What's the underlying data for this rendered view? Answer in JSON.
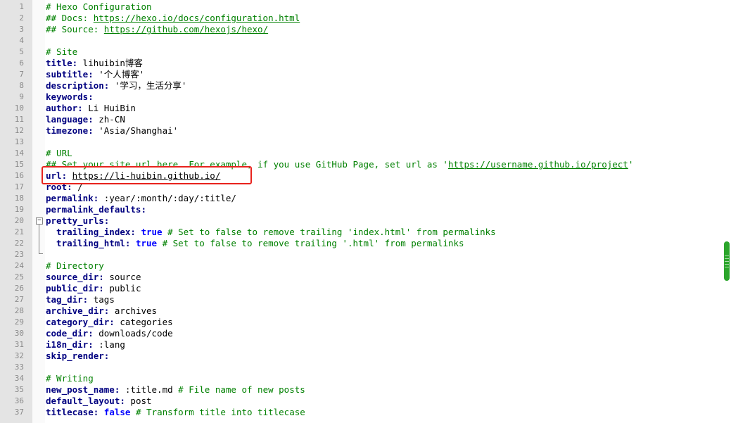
{
  "editor": {
    "lines": [
      {
        "n": "1",
        "parts": [
          {
            "t": "# Hexo Configuration",
            "c": "cm"
          }
        ]
      },
      {
        "n": "2",
        "parts": [
          {
            "t": "## Docs: ",
            "c": "cm"
          },
          {
            "t": "https://hexo.io/docs/configuration.html",
            "c": "ul"
          }
        ]
      },
      {
        "n": "3",
        "parts": [
          {
            "t": "## Source: ",
            "c": "cm"
          },
          {
            "t": "https://github.com/hexojs/hexo/",
            "c": "ul"
          }
        ]
      },
      {
        "n": "4",
        "parts": []
      },
      {
        "n": "5",
        "parts": [
          {
            "t": "# Site",
            "c": "cm"
          }
        ]
      },
      {
        "n": "6",
        "parts": [
          {
            "t": "title:",
            "c": "key"
          },
          {
            "t": " lihuibin博客",
            "c": "val"
          }
        ]
      },
      {
        "n": "7",
        "parts": [
          {
            "t": "subtitle:",
            "c": "key"
          },
          {
            "t": " '个人博客'",
            "c": "val"
          }
        ]
      },
      {
        "n": "8",
        "parts": [
          {
            "t": "description:",
            "c": "key"
          },
          {
            "t": " '学习，生活分享'",
            "c": "val"
          }
        ]
      },
      {
        "n": "9",
        "parts": [
          {
            "t": "keywords:",
            "c": "key"
          }
        ]
      },
      {
        "n": "10",
        "parts": [
          {
            "t": "author:",
            "c": "key"
          },
          {
            "t": " Li HuiBin",
            "c": "val"
          }
        ]
      },
      {
        "n": "11",
        "parts": [
          {
            "t": "language:",
            "c": "key"
          },
          {
            "t": " zh-CN",
            "c": "val"
          }
        ]
      },
      {
        "n": "12",
        "parts": [
          {
            "t": "timezone:",
            "c": "key"
          },
          {
            "t": " 'Asia/Shanghai'",
            "c": "val"
          }
        ]
      },
      {
        "n": "13",
        "parts": []
      },
      {
        "n": "14",
        "parts": [
          {
            "t": "# URL",
            "c": "cm"
          }
        ]
      },
      {
        "n": "15",
        "parts": [
          {
            "t": "## Set your site url here. For example, if you use GitHub Page, set url as '",
            "c": "cm"
          },
          {
            "t": "https://username.github.io/project",
            "c": "ul"
          },
          {
            "t": "'",
            "c": "cm"
          }
        ]
      },
      {
        "n": "16",
        "parts": [
          {
            "t": "url:",
            "c": "key"
          },
          {
            "t": " ",
            "c": "val"
          },
          {
            "t": "https://li-huibin.github.io/",
            "c": "ul val"
          }
        ]
      },
      {
        "n": "17",
        "parts": [
          {
            "t": "root:",
            "c": "key"
          },
          {
            "t": " /",
            "c": "val"
          }
        ]
      },
      {
        "n": "18",
        "parts": [
          {
            "t": "permalink:",
            "c": "key"
          },
          {
            "t": " :year/:month/:day/:title/",
            "c": "val"
          }
        ]
      },
      {
        "n": "19",
        "parts": [
          {
            "t": "permalink_defaults:",
            "c": "key"
          }
        ]
      },
      {
        "n": "20",
        "parts": [
          {
            "t": "pretty_urls:",
            "c": "key"
          }
        ]
      },
      {
        "n": "21",
        "parts": [
          {
            "t": "  trailing_index:",
            "c": "key"
          },
          {
            "t": " ",
            "c": "val"
          },
          {
            "t": "true",
            "c": "bool"
          },
          {
            "t": " # Set to false to remove trailing 'index.html' from permalinks",
            "c": "cm"
          }
        ]
      },
      {
        "n": "22",
        "parts": [
          {
            "t": "  trailing_html:",
            "c": "key"
          },
          {
            "t": " ",
            "c": "val"
          },
          {
            "t": "true",
            "c": "bool"
          },
          {
            "t": " # Set to false to remove trailing '.html' from permalinks",
            "c": "cm"
          }
        ]
      },
      {
        "n": "23",
        "parts": []
      },
      {
        "n": "24",
        "parts": [
          {
            "t": "# Directory",
            "c": "cm"
          }
        ]
      },
      {
        "n": "25",
        "parts": [
          {
            "t": "source_dir:",
            "c": "key"
          },
          {
            "t": " source",
            "c": "val"
          }
        ]
      },
      {
        "n": "26",
        "parts": [
          {
            "t": "public_dir:",
            "c": "key"
          },
          {
            "t": " public",
            "c": "val"
          }
        ]
      },
      {
        "n": "27",
        "parts": [
          {
            "t": "tag_dir:",
            "c": "key"
          },
          {
            "t": " tags",
            "c": "val"
          }
        ]
      },
      {
        "n": "28",
        "parts": [
          {
            "t": "archive_dir:",
            "c": "key"
          },
          {
            "t": " archives",
            "c": "val"
          }
        ]
      },
      {
        "n": "29",
        "parts": [
          {
            "t": "category_dir:",
            "c": "key"
          },
          {
            "t": " categories",
            "c": "val"
          }
        ]
      },
      {
        "n": "30",
        "parts": [
          {
            "t": "code_dir:",
            "c": "key"
          },
          {
            "t": " downloads/code",
            "c": "val"
          }
        ]
      },
      {
        "n": "31",
        "parts": [
          {
            "t": "i18n_dir:",
            "c": "key"
          },
          {
            "t": " :lang",
            "c": "val"
          }
        ]
      },
      {
        "n": "32",
        "parts": [
          {
            "t": "skip_render:",
            "c": "key"
          }
        ]
      },
      {
        "n": "33",
        "parts": []
      },
      {
        "n": "34",
        "parts": [
          {
            "t": "# Writing",
            "c": "cm"
          }
        ]
      },
      {
        "n": "35",
        "parts": [
          {
            "t": "new_post_name:",
            "c": "key"
          },
          {
            "t": " :title.md ",
            "c": "val"
          },
          {
            "t": "# File name of new posts",
            "c": "cm"
          }
        ]
      },
      {
        "n": "36",
        "parts": [
          {
            "t": "default_layout:",
            "c": "key"
          },
          {
            "t": " post",
            "c": "val"
          }
        ]
      },
      {
        "n": "37",
        "parts": [
          {
            "t": "titlecase:",
            "c": "key"
          },
          {
            "t": " ",
            "c": "val"
          },
          {
            "t": "false",
            "c": "bool"
          },
          {
            "t": " # Transform title into titlecase",
            "c": "cm"
          }
        ]
      }
    ],
    "fold_icon": "fold-collapse-icon",
    "fold_symbol": "−",
    "highlighted_line": "16"
  },
  "colors": {
    "key": "#000080",
    "comment": "#008000",
    "highlight_border": "#e8231d",
    "scroll_thumb": "#2ba52b"
  }
}
